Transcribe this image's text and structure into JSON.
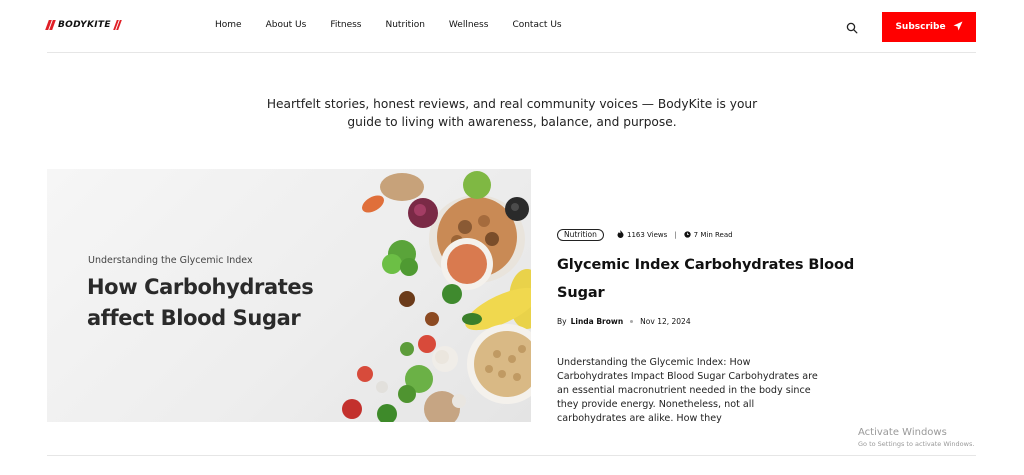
{
  "brand": {
    "name": "BODYKITE",
    "accent": "#ff0000"
  },
  "nav": {
    "items": [
      {
        "label": "Home"
      },
      {
        "label": "About Us"
      },
      {
        "label": "Fitness"
      },
      {
        "label": "Nutrition"
      },
      {
        "label": "Wellness"
      },
      {
        "label": "Contact Us"
      }
    ]
  },
  "header": {
    "search_icon": "search-icon",
    "subscribe_label": "Subscribe",
    "subscribe_icon": "send-icon"
  },
  "tagline": "Heartfelt stories, honest reviews, and real community voices — BodyKite is your guide to living with awareness, balance, and purpose.",
  "featured": {
    "image": {
      "subtitle": "Understanding the Glycemic Index",
      "title": "How Carbohydrates affect Blood Sugar"
    },
    "category": "Nutrition",
    "views": "1163 Views",
    "read_time": "7 Min Read",
    "title": "Glycemic Index Carbohydrates Blood Sugar",
    "by": "By",
    "author": "Linda Brown",
    "date": "Nov 12, 2024",
    "excerpt": "Understanding the Glycemic Index: How Carbohydrates Impact Blood Sugar Carbohydrates are an essential macronutrient needed in the body since they provide energy. Nonetheless, not all carbohydrates are alike. How they"
  },
  "watermark": {
    "title": "Activate Windows",
    "subtitle": "Go to Settings to activate Windows."
  }
}
